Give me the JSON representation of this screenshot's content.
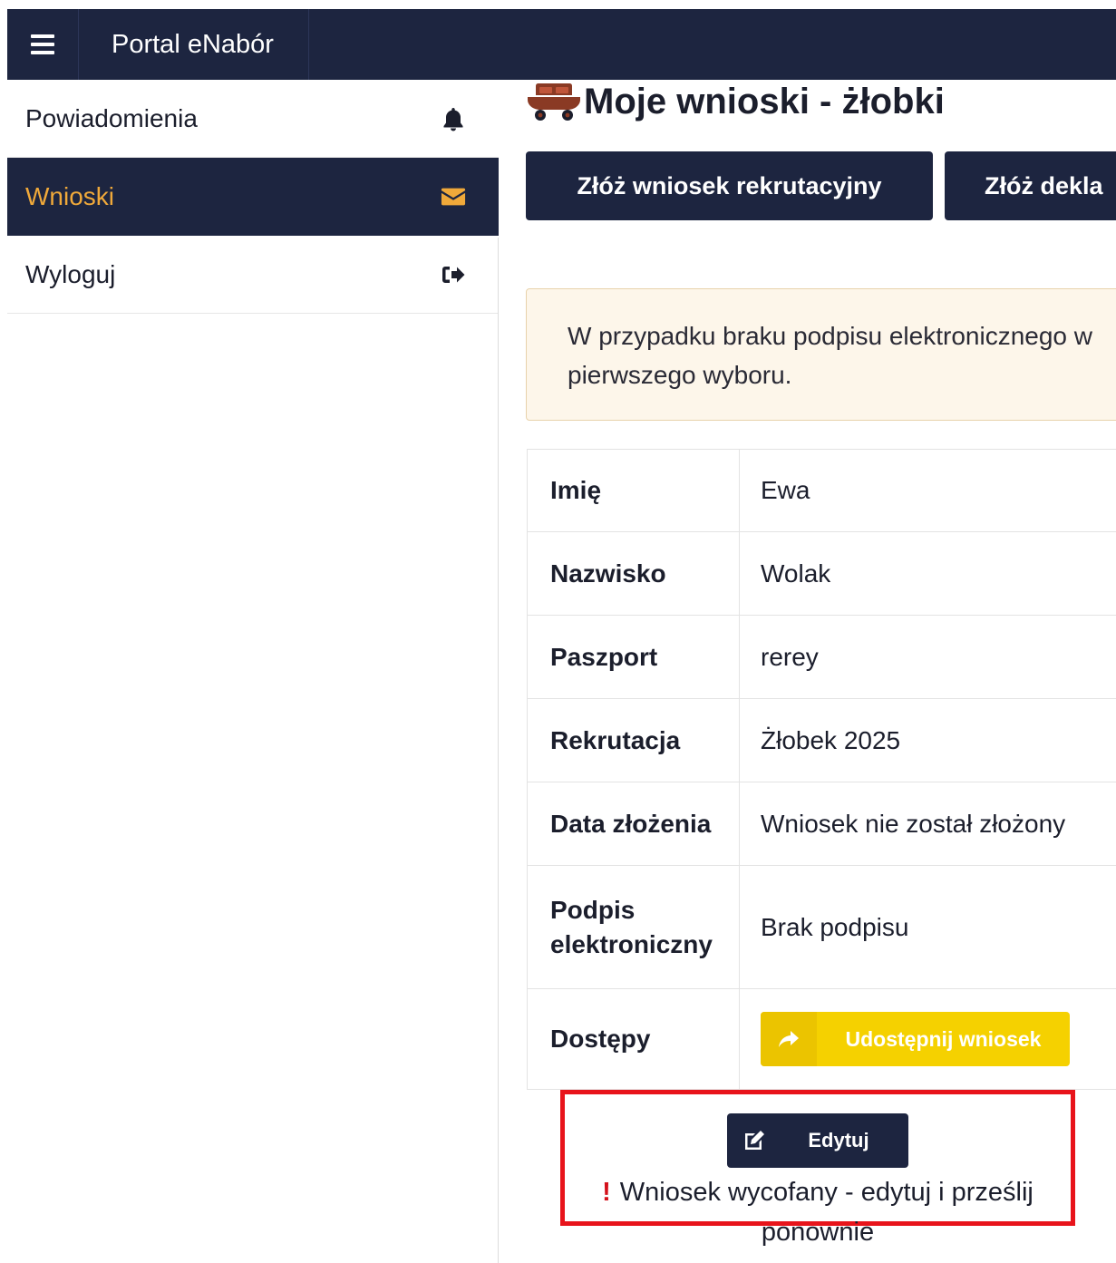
{
  "topbar": {
    "menu_icon": "hamburger-icon",
    "brand": "Portal eNabór"
  },
  "sidebar": {
    "items": [
      {
        "label": "Powiadomienia",
        "icon": "bell-icon",
        "active": false
      },
      {
        "label": "Wnioski",
        "icon": "envelope-icon",
        "active": true
      },
      {
        "label": "Wyloguj",
        "icon": "sign-out-icon",
        "active": false
      }
    ],
    "active_color": "#f0a93a"
  },
  "main": {
    "title": "Moje wnioski - żłobki",
    "title_icon": "stroller-icon",
    "buttons": {
      "submit_application": "Złóż wniosek rekrutacyjny",
      "submit_declaration": "Złóż dekla"
    },
    "alert": {
      "line1": "W przypadku braku podpisu elektronicznego w",
      "line2": "pierwszego wyboru."
    },
    "table": {
      "rows": [
        {
          "key": "Imię",
          "value": "Ewa"
        },
        {
          "key": "Nazwisko",
          "value": "Wolak"
        },
        {
          "key": "Paszport",
          "value": "rerey"
        },
        {
          "key": "Rekrutacja",
          "value": "Żłobek 2025"
        },
        {
          "key": "Data złożenia",
          "value": "Wniosek nie został złożony"
        },
        {
          "key_line1": "Podpis",
          "key_line2": "elektroniczny",
          "value": "Brak podpisu"
        },
        {
          "key": "Dostępy",
          "share_label": "Udostępnij wniosek",
          "share_icon": "share-icon"
        }
      ]
    },
    "edit": {
      "label": "Edytuj",
      "icon": "edit-icon",
      "warning_icon": "exclamation-icon",
      "warning_text": "Wniosek wycofany - edytuj i prześlij ponownie"
    }
  },
  "colors": {
    "navy": "#1d2540",
    "accent_orange": "#f0a93a",
    "yellow": "#f5d100",
    "alert_bg": "#fdf6ea",
    "highlight_red": "#e8141b"
  }
}
